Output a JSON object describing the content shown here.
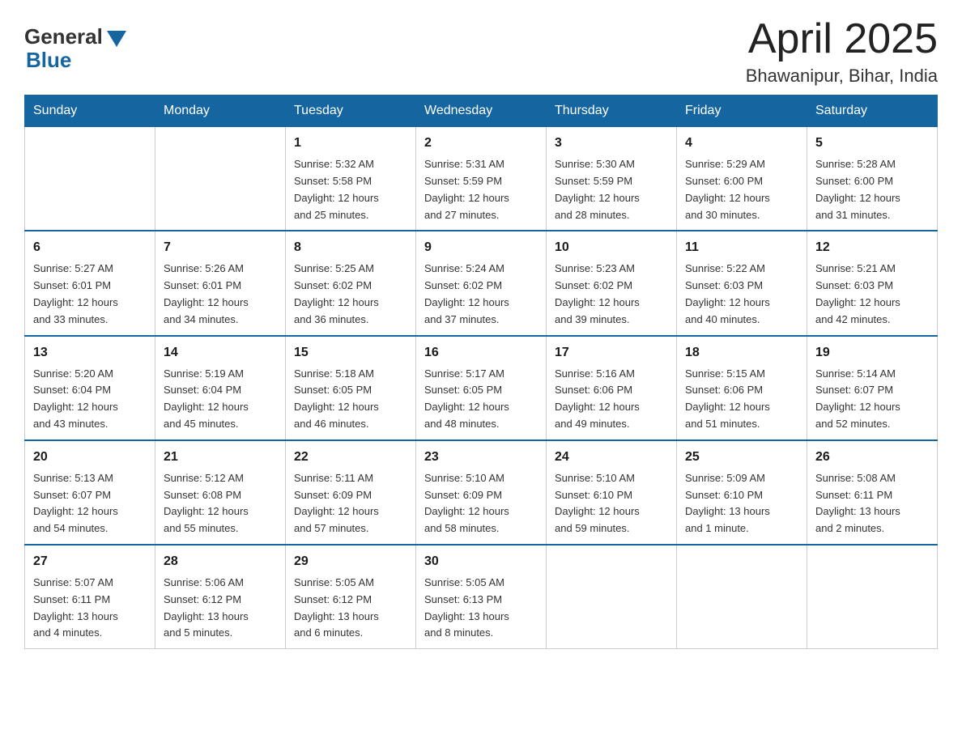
{
  "header": {
    "logo_general": "General",
    "logo_blue": "Blue",
    "month_title": "April 2025",
    "location": "Bhawanipur, Bihar, India"
  },
  "days_of_week": [
    "Sunday",
    "Monday",
    "Tuesday",
    "Wednesday",
    "Thursday",
    "Friday",
    "Saturday"
  ],
  "weeks": [
    [
      {
        "day": "",
        "info": ""
      },
      {
        "day": "",
        "info": ""
      },
      {
        "day": "1",
        "info": "Sunrise: 5:32 AM\nSunset: 5:58 PM\nDaylight: 12 hours\nand 25 minutes."
      },
      {
        "day": "2",
        "info": "Sunrise: 5:31 AM\nSunset: 5:59 PM\nDaylight: 12 hours\nand 27 minutes."
      },
      {
        "day": "3",
        "info": "Sunrise: 5:30 AM\nSunset: 5:59 PM\nDaylight: 12 hours\nand 28 minutes."
      },
      {
        "day": "4",
        "info": "Sunrise: 5:29 AM\nSunset: 6:00 PM\nDaylight: 12 hours\nand 30 minutes."
      },
      {
        "day": "5",
        "info": "Sunrise: 5:28 AM\nSunset: 6:00 PM\nDaylight: 12 hours\nand 31 minutes."
      }
    ],
    [
      {
        "day": "6",
        "info": "Sunrise: 5:27 AM\nSunset: 6:01 PM\nDaylight: 12 hours\nand 33 minutes."
      },
      {
        "day": "7",
        "info": "Sunrise: 5:26 AM\nSunset: 6:01 PM\nDaylight: 12 hours\nand 34 minutes."
      },
      {
        "day": "8",
        "info": "Sunrise: 5:25 AM\nSunset: 6:02 PM\nDaylight: 12 hours\nand 36 minutes."
      },
      {
        "day": "9",
        "info": "Sunrise: 5:24 AM\nSunset: 6:02 PM\nDaylight: 12 hours\nand 37 minutes."
      },
      {
        "day": "10",
        "info": "Sunrise: 5:23 AM\nSunset: 6:02 PM\nDaylight: 12 hours\nand 39 minutes."
      },
      {
        "day": "11",
        "info": "Sunrise: 5:22 AM\nSunset: 6:03 PM\nDaylight: 12 hours\nand 40 minutes."
      },
      {
        "day": "12",
        "info": "Sunrise: 5:21 AM\nSunset: 6:03 PM\nDaylight: 12 hours\nand 42 minutes."
      }
    ],
    [
      {
        "day": "13",
        "info": "Sunrise: 5:20 AM\nSunset: 6:04 PM\nDaylight: 12 hours\nand 43 minutes."
      },
      {
        "day": "14",
        "info": "Sunrise: 5:19 AM\nSunset: 6:04 PM\nDaylight: 12 hours\nand 45 minutes."
      },
      {
        "day": "15",
        "info": "Sunrise: 5:18 AM\nSunset: 6:05 PM\nDaylight: 12 hours\nand 46 minutes."
      },
      {
        "day": "16",
        "info": "Sunrise: 5:17 AM\nSunset: 6:05 PM\nDaylight: 12 hours\nand 48 minutes."
      },
      {
        "day": "17",
        "info": "Sunrise: 5:16 AM\nSunset: 6:06 PM\nDaylight: 12 hours\nand 49 minutes."
      },
      {
        "day": "18",
        "info": "Sunrise: 5:15 AM\nSunset: 6:06 PM\nDaylight: 12 hours\nand 51 minutes."
      },
      {
        "day": "19",
        "info": "Sunrise: 5:14 AM\nSunset: 6:07 PM\nDaylight: 12 hours\nand 52 minutes."
      }
    ],
    [
      {
        "day": "20",
        "info": "Sunrise: 5:13 AM\nSunset: 6:07 PM\nDaylight: 12 hours\nand 54 minutes."
      },
      {
        "day": "21",
        "info": "Sunrise: 5:12 AM\nSunset: 6:08 PM\nDaylight: 12 hours\nand 55 minutes."
      },
      {
        "day": "22",
        "info": "Sunrise: 5:11 AM\nSunset: 6:09 PM\nDaylight: 12 hours\nand 57 minutes."
      },
      {
        "day": "23",
        "info": "Sunrise: 5:10 AM\nSunset: 6:09 PM\nDaylight: 12 hours\nand 58 minutes."
      },
      {
        "day": "24",
        "info": "Sunrise: 5:10 AM\nSunset: 6:10 PM\nDaylight: 12 hours\nand 59 minutes."
      },
      {
        "day": "25",
        "info": "Sunrise: 5:09 AM\nSunset: 6:10 PM\nDaylight: 13 hours\nand 1 minute."
      },
      {
        "day": "26",
        "info": "Sunrise: 5:08 AM\nSunset: 6:11 PM\nDaylight: 13 hours\nand 2 minutes."
      }
    ],
    [
      {
        "day": "27",
        "info": "Sunrise: 5:07 AM\nSunset: 6:11 PM\nDaylight: 13 hours\nand 4 minutes."
      },
      {
        "day": "28",
        "info": "Sunrise: 5:06 AM\nSunset: 6:12 PM\nDaylight: 13 hours\nand 5 minutes."
      },
      {
        "day": "29",
        "info": "Sunrise: 5:05 AM\nSunset: 6:12 PM\nDaylight: 13 hours\nand 6 minutes."
      },
      {
        "day": "30",
        "info": "Sunrise: 5:05 AM\nSunset: 6:13 PM\nDaylight: 13 hours\nand 8 minutes."
      },
      {
        "day": "",
        "info": ""
      },
      {
        "day": "",
        "info": ""
      },
      {
        "day": "",
        "info": ""
      }
    ]
  ]
}
